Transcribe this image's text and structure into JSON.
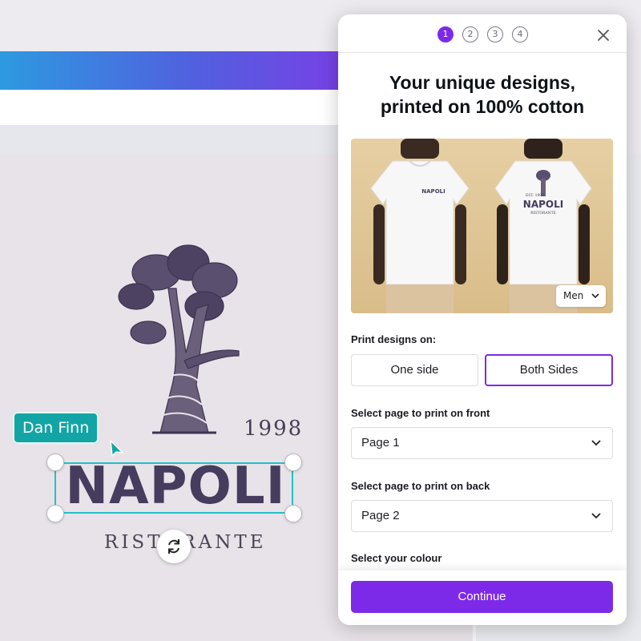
{
  "editor": {
    "design": {
      "year": "1998",
      "name": "NAPOLI",
      "subtitle": "RISTORANTE"
    },
    "collaborator_tag": "Dan Finn",
    "icons": [
      "tree-illustration",
      "rotate-icon",
      "cursor-icon"
    ]
  },
  "modal": {
    "steps": [
      "1",
      "2",
      "3",
      "4"
    ],
    "active_step": "1",
    "title_line1": "Your unique designs,",
    "title_line2": "printed on 100% cotton",
    "preview": {
      "shirt_logo_year": "EST. 1998",
      "shirt_logo_name": "NAPOLI",
      "shirt_logo_sub": "RISTORANTE",
      "gender_select": "Men"
    },
    "print_label": "Print designs on:",
    "print_options": [
      "One side",
      "Both Sides"
    ],
    "print_selected": "Both Sides",
    "front_label": "Select page to print on front",
    "front_value": "Page 1",
    "back_label": "Select page to print on back",
    "back_value": "Page 2",
    "colour_label": "Select your colour",
    "continue_label": "Continue"
  },
  "colors": {
    "accent": "#7d2ae8",
    "selection": "#20c2c9",
    "collaborator": "#13a5a5",
    "design_ink": "#463c5e"
  }
}
